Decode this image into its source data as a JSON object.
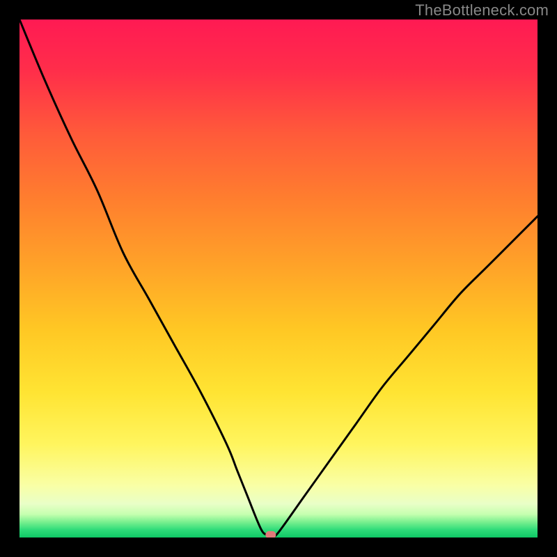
{
  "watermark": "TheBottleneck.com",
  "chart_data": {
    "type": "line",
    "title": "",
    "xlabel": "",
    "ylabel": "",
    "xlim": [
      0,
      100
    ],
    "ylim": [
      0,
      100
    ],
    "grid": false,
    "legend": false,
    "x": [
      0,
      5,
      10,
      15,
      20,
      25,
      30,
      35,
      40,
      42,
      44,
      46,
      47,
      48,
      49,
      50,
      55,
      60,
      65,
      70,
      75,
      80,
      85,
      90,
      95,
      100
    ],
    "y": [
      100,
      88,
      77,
      67,
      55,
      46,
      37,
      28,
      18,
      13,
      8,
      3,
      1,
      0.5,
      0.5,
      1,
      8,
      15,
      22,
      29,
      35,
      41,
      47,
      52,
      57,
      62
    ],
    "marker": {
      "x_pct": 48.5,
      "y_pct": 0.5,
      "color": "#e07a7a"
    },
    "gradient_stops": [
      {
        "offset": 0.0,
        "color": "#ff1a53"
      },
      {
        "offset": 0.1,
        "color": "#ff2e4a"
      },
      {
        "offset": 0.22,
        "color": "#ff5a3a"
      },
      {
        "offset": 0.35,
        "color": "#ff7f2e"
      },
      {
        "offset": 0.48,
        "color": "#ffa428"
      },
      {
        "offset": 0.6,
        "color": "#ffc824"
      },
      {
        "offset": 0.72,
        "color": "#ffe433"
      },
      {
        "offset": 0.82,
        "color": "#fff55e"
      },
      {
        "offset": 0.9,
        "color": "#f9ffa6"
      },
      {
        "offset": 0.935,
        "color": "#e9ffc7"
      },
      {
        "offset": 0.955,
        "color": "#c6ffb0"
      },
      {
        "offset": 0.97,
        "color": "#7af08f"
      },
      {
        "offset": 0.985,
        "color": "#2fdc7a"
      },
      {
        "offset": 1.0,
        "color": "#0fc865"
      }
    ]
  }
}
